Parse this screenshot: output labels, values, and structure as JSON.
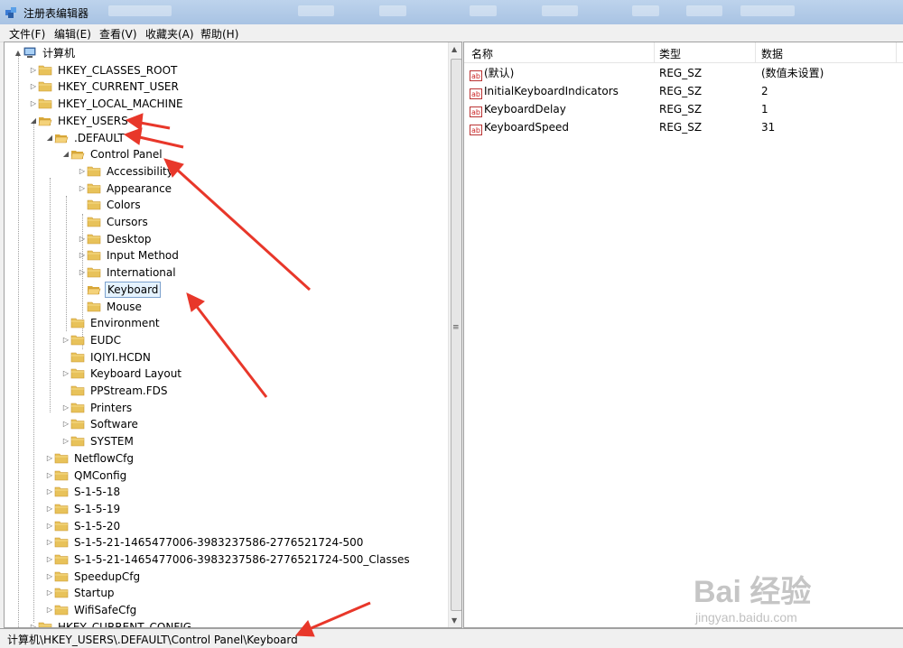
{
  "window": {
    "title": "注册表编辑器"
  },
  "menu": [
    "文件(F)",
    "编辑(E)",
    "查看(V)",
    "收藏夹(A)",
    "帮助(H)"
  ],
  "tree": [
    {
      "label": "计算机",
      "expander": "▲",
      "icon": "computer-icon"
    },
    {
      "label": "HKEY_CLASSES_ROOT",
      "expander": "▷",
      "icon": "folder-icon"
    },
    {
      "label": "HKEY_CURRENT_USER",
      "expander": "▷",
      "icon": "folder-icon"
    },
    {
      "label": "HKEY_LOCAL_MACHINE",
      "expander": "▷",
      "icon": "folder-icon"
    },
    {
      "label": "HKEY_USERS",
      "expander": "◢",
      "icon": "folder-open-icon"
    },
    {
      "label": ".DEFAULT",
      "expander": "◢",
      "icon": "folder-open-icon"
    },
    {
      "label": "Control Panel",
      "expander": "◢",
      "icon": "folder-open-icon"
    },
    {
      "label": "Accessibility",
      "expander": "▷",
      "icon": "folder-icon"
    },
    {
      "label": "Appearance",
      "expander": "▷",
      "icon": "folder-icon"
    },
    {
      "label": "Colors",
      "expander": "",
      "icon": "folder-icon"
    },
    {
      "label": "Cursors",
      "expander": "",
      "icon": "folder-icon"
    },
    {
      "label": "Desktop",
      "expander": "▷",
      "icon": "folder-icon"
    },
    {
      "label": "Input Method",
      "expander": "▷",
      "icon": "folder-icon"
    },
    {
      "label": "International",
      "expander": "▷",
      "icon": "folder-icon"
    },
    {
      "label": "Keyboard",
      "expander": "",
      "icon": "folder-open-icon"
    },
    {
      "label": "Mouse",
      "expander": "",
      "icon": "folder-icon"
    },
    {
      "label": "Environment",
      "expander": "",
      "icon": "folder-icon"
    },
    {
      "label": "EUDC",
      "expander": "▷",
      "icon": "folder-icon"
    },
    {
      "label": "IQIYI.HCDN",
      "expander": "",
      "icon": "folder-icon"
    },
    {
      "label": "Keyboard Layout",
      "expander": "▷",
      "icon": "folder-icon"
    },
    {
      "label": "PPStream.FDS",
      "expander": "",
      "icon": "folder-icon"
    },
    {
      "label": "Printers",
      "expander": "▷",
      "icon": "folder-icon"
    },
    {
      "label": "Software",
      "expander": "▷",
      "icon": "folder-icon"
    },
    {
      "label": "SYSTEM",
      "expander": "▷",
      "icon": "folder-icon"
    },
    {
      "label": "NetflowCfg",
      "expander": "▷",
      "icon": "folder-icon"
    },
    {
      "label": "QMConfig",
      "expander": "▷",
      "icon": "folder-icon"
    },
    {
      "label": "S-1-5-18",
      "expander": "▷",
      "icon": "folder-icon"
    },
    {
      "label": "S-1-5-19",
      "expander": "▷",
      "icon": "folder-icon"
    },
    {
      "label": "S-1-5-20",
      "expander": "▷",
      "icon": "folder-icon"
    },
    {
      "label": "S-1-5-21-1465477006-3983237586-2776521724-500",
      "expander": "▷",
      "icon": "folder-icon"
    },
    {
      "label": "S-1-5-21-1465477006-3983237586-2776521724-500_Classes",
      "expander": "▷",
      "icon": "folder-icon"
    },
    {
      "label": "SpeedupCfg",
      "expander": "▷",
      "icon": "folder-icon"
    },
    {
      "label": "Startup",
      "expander": "▷",
      "icon": "folder-icon"
    },
    {
      "label": "WifiSafeCfg",
      "expander": "▷",
      "icon": "folder-icon"
    },
    {
      "label": "HKEY_CURRENT_CONFIG",
      "expander": "▷",
      "icon": "folder-icon"
    }
  ],
  "values_table": {
    "headers": [
      "名称",
      "类型",
      "数据"
    ],
    "rows": [
      {
        "name": "(默认)",
        "type": "REG_SZ",
        "data": "(数值未设置)"
      },
      {
        "name": "InitialKeyboardIndicators",
        "type": "REG_SZ",
        "data": "2"
      },
      {
        "name": "KeyboardDelay",
        "type": "REG_SZ",
        "data": "1"
      },
      {
        "name": "KeyboardSpeed",
        "type": "REG_SZ",
        "data": "31"
      }
    ]
  },
  "status": {
    "path": "计算机\\HKEY_USERS\\.DEFAULT\\Control Panel\\Keyboard"
  },
  "watermark": {
    "brand": "Bai 经验",
    "url": "jingyan.baidu.com"
  },
  "colors": {
    "annotation_arrow": "#e8372a",
    "selection": "#e5f3ff",
    "folder": "#e8c25a"
  }
}
